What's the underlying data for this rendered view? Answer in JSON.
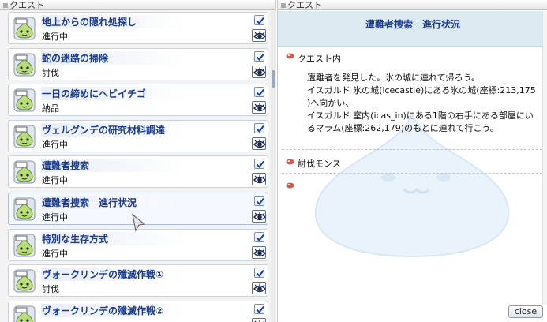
{
  "left_window": {
    "title": "クエスト"
  },
  "right_window": {
    "title": "クエスト"
  },
  "quests": [
    {
      "title": "地上からの隠れ処探し",
      "status": "進行中",
      "checked": true
    },
    {
      "title": "蛇の迷路の掃除",
      "status": "討伐",
      "checked": true
    },
    {
      "title": "一日の締めにへビイチゴ",
      "status": "納品",
      "checked": true
    },
    {
      "title": "ヴェルグンデの研究材料調達",
      "status": "進行中",
      "checked": true
    },
    {
      "title": "遭難者捜索",
      "status": "進行中",
      "checked": true
    },
    {
      "title": "遭難者捜索　進行状況",
      "status": "進行中",
      "checked": true,
      "selected": true
    },
    {
      "title": "特別な生存方式",
      "status": "進行中",
      "checked": true
    },
    {
      "title": "ヴォークリンデの殲滅作戦①",
      "status": "討伐",
      "checked": true
    },
    {
      "title": "ヴォークリンデの殲滅作戦②",
      "status": "",
      "checked": true
    }
  ],
  "detail": {
    "title": "遭難者捜索　進行状況",
    "content_label": "クエスト内",
    "content_lines": [
      "遭難者を発見した。氷の城に連れて帰ろう。",
      "イスガルド 氷の城(icecastle)にある氷の城(座標:213,175",
      ")へ向かい、",
      "イスガルド 室内(icas_in)にある1階の右手にある部屋にい",
      "るマラム(座標:262,179)のもとに連れて行こう。"
    ],
    "monster_label": "討伐モンス",
    "reward_label": ""
  },
  "buttons": {
    "close": "close"
  },
  "colors": {
    "title_text": "#1a3a8a",
    "header_bg": "#dceaf2",
    "bullet": "#c0392b"
  },
  "icons": {
    "quest_icon": "slime-face-icon",
    "check_icon": "checkmark-icon",
    "eye_icon": "eye-icon"
  }
}
